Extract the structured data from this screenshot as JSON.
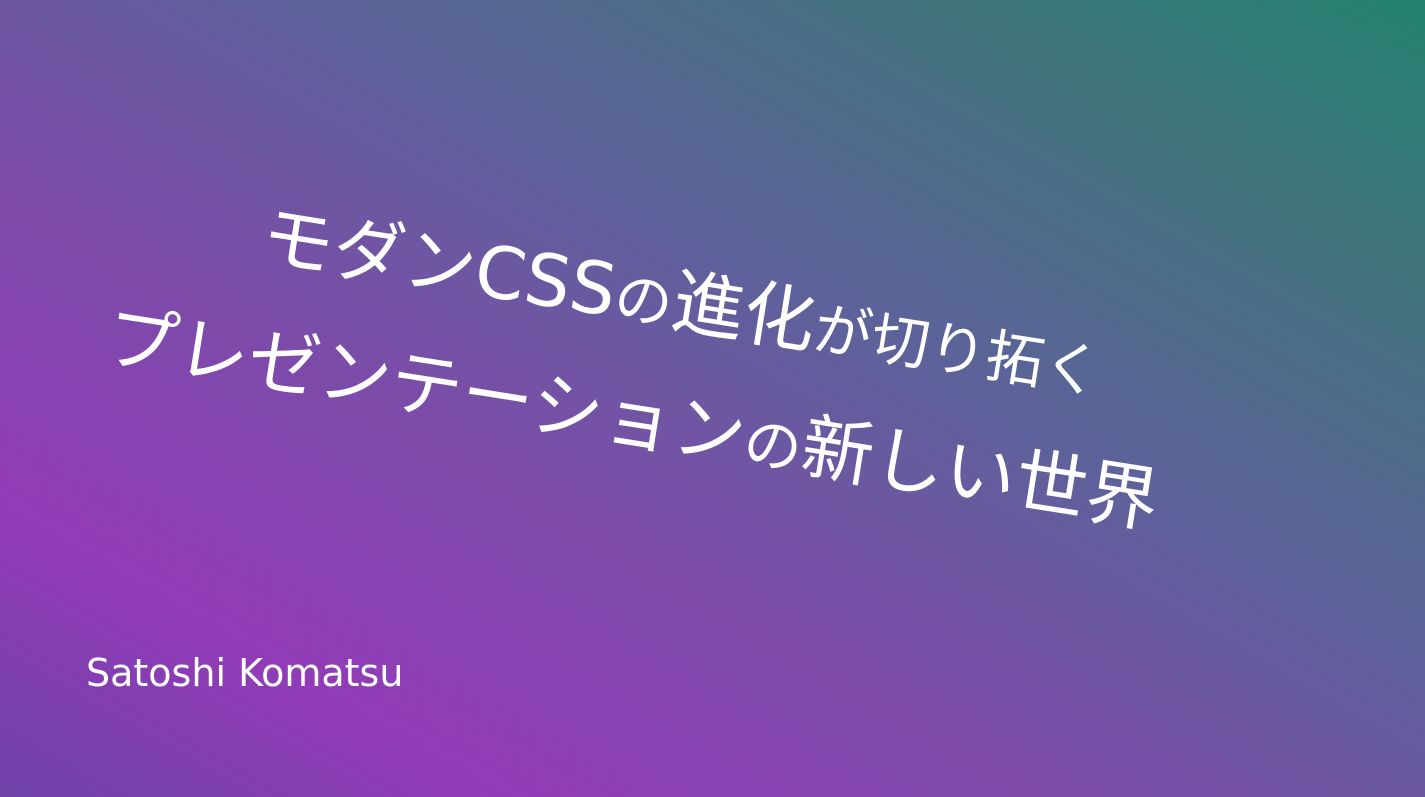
{
  "slide": {
    "title": {
      "line1": {
        "part1": "モダンCSS",
        "part2": "の",
        "part3": "進化",
        "part4": "が切り拓く"
      },
      "line2": {
        "part1": "プレゼンテーション",
        "part2": "の",
        "part3": "新しい世界"
      }
    },
    "author": "Satoshi Komatsu"
  },
  "colors": {
    "gradient_start": "#923bb8",
    "gradient_end": "#23816f",
    "text": "#ffffff"
  }
}
